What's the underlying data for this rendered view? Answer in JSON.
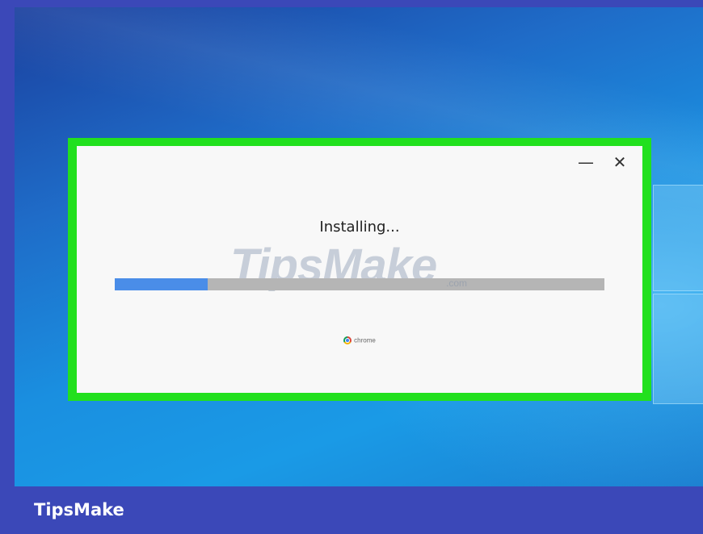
{
  "installer": {
    "status_text": "Installing...",
    "progress_fraction": 0.19,
    "minimize_glyph": "—",
    "close_glyph": "✕",
    "brand_label": "chrome",
    "brand_icon": "chrome-logo-icon"
  },
  "watermark": {
    "main": "TipsMake",
    "sub": ".com"
  },
  "footer": {
    "label": "TipsMake"
  },
  "colors": {
    "highlight_outline": "#22e01e",
    "progress_fill": "#4a8de8",
    "progress_track": "#b5b5b5",
    "footer_bar": "#3b48b8"
  }
}
